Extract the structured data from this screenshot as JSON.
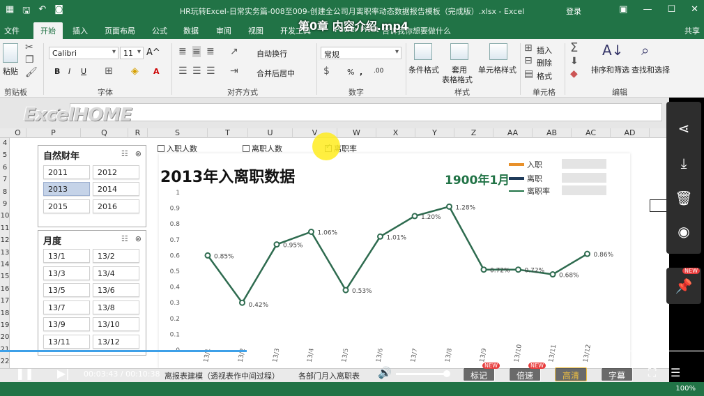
{
  "window": {
    "title": "HR玩转Excel-日常实务篇-008至009-创建全公司月离职率动态数据报告模板（完成版）.xlsx - Excel",
    "login": "登录",
    "video_title": "第0章 内容介绍.mp4"
  },
  "tabs": [
    "文件",
    "开始",
    "插入",
    "页面布局",
    "公式",
    "数据",
    "审阅",
    "视图",
    "开发工具",
    "Power Pivot"
  ],
  "tell_me": "告诉我你想要做什么",
  "share": "共享",
  "ribbon": {
    "paste": "粘贴",
    "clipboard": "剪贴板",
    "font_group": "字体",
    "font_name": "Calibri",
    "font_size": "11",
    "alignment_group": "对齐方式",
    "wrap_text": "自动换行",
    "merge_center": "合并后居中",
    "number_group": "数字",
    "number_format": "常规",
    "conditional": "条件格式",
    "table_format_1": "套用",
    "table_format_2": "表格格式",
    "cell_style": "单元格样式",
    "styles_group": "样式",
    "insert": "插入",
    "delete": "删除",
    "format": "格式",
    "cells_group": "单元格",
    "sort_filter": "排序和筛选",
    "find_select": "查找和选择",
    "editing_group": "编辑"
  },
  "logo": "ExcelHOME",
  "columns": [
    "O",
    "P",
    "Q",
    "R",
    "S",
    "T",
    "U",
    "V",
    "W",
    "X",
    "Y",
    "Z",
    "AA",
    "AB",
    "AC",
    "AD"
  ],
  "rows": [
    "4",
    "5",
    "6",
    "7",
    "8",
    "9",
    "10",
    "11",
    "12",
    "13",
    "14",
    "15",
    "16",
    "17",
    "18",
    "19",
    "20",
    "21",
    "22"
  ],
  "checkboxes": [
    {
      "label": "入职人数",
      "checked": false
    },
    {
      "label": "离职人数",
      "checked": false
    },
    {
      "label": "离职率",
      "checked": true
    }
  ],
  "slicer_year": {
    "title": "自然财年",
    "items": [
      "2011",
      "2012",
      "2013",
      "2014",
      "2015",
      "2016"
    ],
    "selected": "2013"
  },
  "slicer_month": {
    "title": "月度",
    "items": [
      "13/1",
      "13/2",
      "13/3",
      "13/4",
      "13/5",
      "13/6",
      "13/7",
      "13/8",
      "13/9",
      "13/10",
      "13/11",
      "13/12"
    ]
  },
  "chart_data": {
    "type": "line",
    "title": "2013年入离职数据",
    "subtitle": "1900年1月",
    "legend": [
      "入职",
      "离职",
      "离职率"
    ],
    "legend_colors": [
      "#e8902a",
      "#1f3b5a",
      "#217346"
    ],
    "categories": [
      "13/1",
      "13/2",
      "13/3",
      "13/4",
      "13/5",
      "13/6",
      "13/7",
      "13/8",
      "13/9",
      "13/10",
      "13/11",
      "13/12"
    ],
    "series": [
      {
        "name": "离职率",
        "values": [
          0.6,
          0.3,
          0.67,
          0.75,
          0.38,
          0.72,
          0.85,
          0.91,
          0.51,
          0.51,
          0.48,
          0.61
        ],
        "labels": [
          "0.85%",
          "0.42%",
          "0.95%",
          "1.06%",
          "0.53%",
          "1.01%",
          "1.20%",
          "1.28%",
          "0.72%",
          "0.72%",
          "0.68%",
          "0.86%"
        ]
      }
    ],
    "y_ticks": [
      "0",
      "0.1",
      "0.2",
      "0.3",
      "0.4",
      "0.5",
      "0.6",
      "0.7",
      "0.8",
      "0.9",
      "1"
    ],
    "ylim": [
      0,
      1
    ]
  },
  "sheet_tabs": [
    "离报表建模（透视表作中间过程）",
    "各部门月入离职表"
  ],
  "video": {
    "current_time": "00:03:43",
    "total_time": "00:10:38",
    "progress": 0.35,
    "btn_mark": "标记",
    "btn_speed": "倍速",
    "btn_quality": "高清",
    "btn_subtitle": "字幕",
    "new_badge": "NEW"
  },
  "statusbar": {
    "zoom": "100%"
  }
}
